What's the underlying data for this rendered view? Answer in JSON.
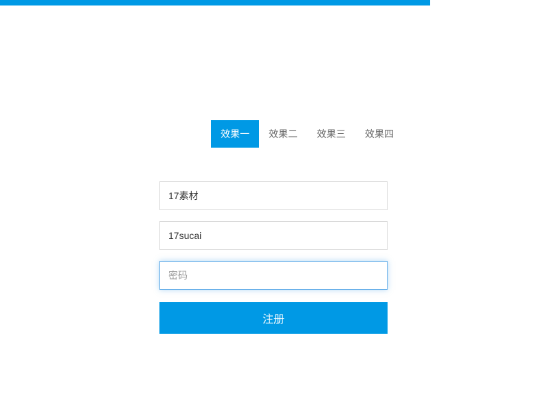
{
  "tabs": [
    {
      "label": "效果一",
      "active": true
    },
    {
      "label": "效果二",
      "active": false
    },
    {
      "label": "效果三",
      "active": false
    },
    {
      "label": "效果四",
      "active": false
    }
  ],
  "form": {
    "field1_value": "17素材",
    "field2_value": "17sucai",
    "field3_placeholder": "密码",
    "field3_value": "",
    "submit_label": "注册"
  },
  "colors": {
    "primary": "#0099e5"
  }
}
